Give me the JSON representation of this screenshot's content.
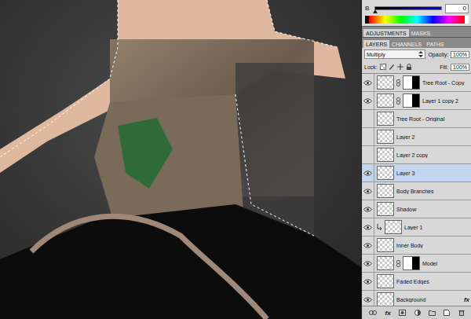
{
  "color_panel": {
    "channel": "B",
    "value": "0",
    "level": 0
  },
  "panel_tabs": [
    {
      "label": "ADJUSTMENTS",
      "selected": true
    },
    {
      "label": "MASKS",
      "selected": false
    }
  ],
  "layer_tabs": [
    {
      "label": "LAYERS",
      "selected": true
    },
    {
      "label": "CHANNELS",
      "selected": false
    },
    {
      "label": "PATHS",
      "selected": false
    }
  ],
  "blend_mode": "Multiply",
  "opacity": {
    "label": "Opacity:",
    "value": "100%"
  },
  "lock": {
    "label": "Lock:"
  },
  "fill": {
    "label": "Fill:",
    "value": "100%"
  },
  "layers": [
    {
      "name": "Tree Root - Copy",
      "visible": true,
      "mask": true,
      "clipped": false,
      "underlined": false,
      "selected": false,
      "fx": ""
    },
    {
      "name": "Layer 1 copy 2",
      "visible": true,
      "mask": true,
      "clipped": false,
      "underlined": false,
      "selected": false,
      "fx": ""
    },
    {
      "name": "Tree Root - Original",
      "visible": false,
      "mask": false,
      "clipped": false,
      "underlined": false,
      "selected": false,
      "fx": ""
    },
    {
      "name": "Layer 2",
      "visible": false,
      "mask": false,
      "clipped": false,
      "underlined": false,
      "selected": false,
      "fx": ""
    },
    {
      "name": "Layer 2 copy",
      "visible": false,
      "mask": false,
      "clipped": false,
      "underlined": false,
      "selected": false,
      "fx": ""
    },
    {
      "name": "Layer 3",
      "visible": true,
      "mask": false,
      "clipped": false,
      "underlined": false,
      "selected": true,
      "fx": ""
    },
    {
      "name": "Body Branches",
      "visible": true,
      "mask": false,
      "clipped": false,
      "underlined": false,
      "selected": false,
      "fx": ""
    },
    {
      "name": "Shadow",
      "visible": true,
      "mask": false,
      "clipped": false,
      "underlined": false,
      "selected": false,
      "fx": ""
    },
    {
      "name": "Layer 1",
      "visible": true,
      "mask": false,
      "clipped": true,
      "underlined": false,
      "selected": false,
      "fx": ""
    },
    {
      "name": "Inner Body",
      "visible": true,
      "mask": false,
      "clipped": false,
      "underlined": true,
      "selected": false,
      "fx": ""
    },
    {
      "name": "Model",
      "visible": true,
      "mask": true,
      "clipped": false,
      "underlined": false,
      "selected": false,
      "fx": ""
    },
    {
      "name": "Faded Edges",
      "visible": true,
      "mask": false,
      "clipped": false,
      "underlined": false,
      "selected": false,
      "fx": ""
    },
    {
      "name": "Background",
      "visible": true,
      "mask": false,
      "clipped": false,
      "underlined": false,
      "selected": false,
      "fx": "fx"
    }
  ],
  "bottom_toolbar": {
    "fx_label": "fx"
  }
}
